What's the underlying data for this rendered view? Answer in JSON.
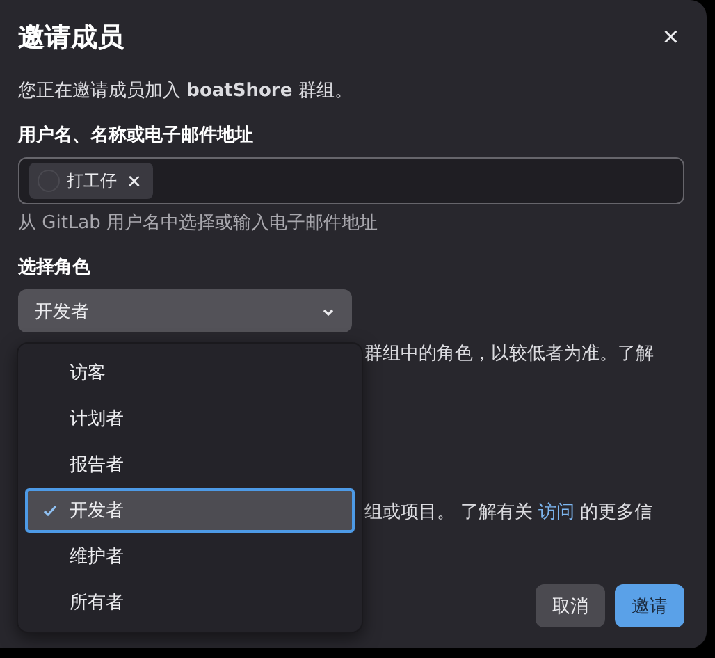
{
  "dialog": {
    "title": "邀请成员",
    "close": "×",
    "intro": "您正在邀请成员加入 **boatShore** 群组。",
    "invitee_label": "用户名、名称或电子邮件地址",
    "invitees": [
      {
        "name": "打工仔",
        "remove": "✕"
      }
    ],
    "invitee_help": "从 GitLab 用户名中选择或输入电子邮件地址",
    "role_label": "选择角色",
    "role_value": "开发者",
    "role_note_visible": "群组中的角色，以较低者为准。了解",
    "access_note_before": "组或项目。 了解有关",
    "access_link": "访问",
    "access_note_after": "的更多信",
    "buttons": [
      {
        "label": "取消",
        "kind": "secondary"
      },
      {
        "label": "邀请",
        "kind": "primary"
      }
    ]
  },
  "role_menu": {
    "items": [
      {
        "label": "访客",
        "selected": false
      },
      {
        "label": "计划者",
        "selected": false
      },
      {
        "label": "报告者",
        "selected": false
      },
      {
        "label": "开发者",
        "selected": true
      },
      {
        "label": "维护者",
        "selected": false
      },
      {
        "label": "所有者",
        "selected": false
      }
    ]
  }
}
